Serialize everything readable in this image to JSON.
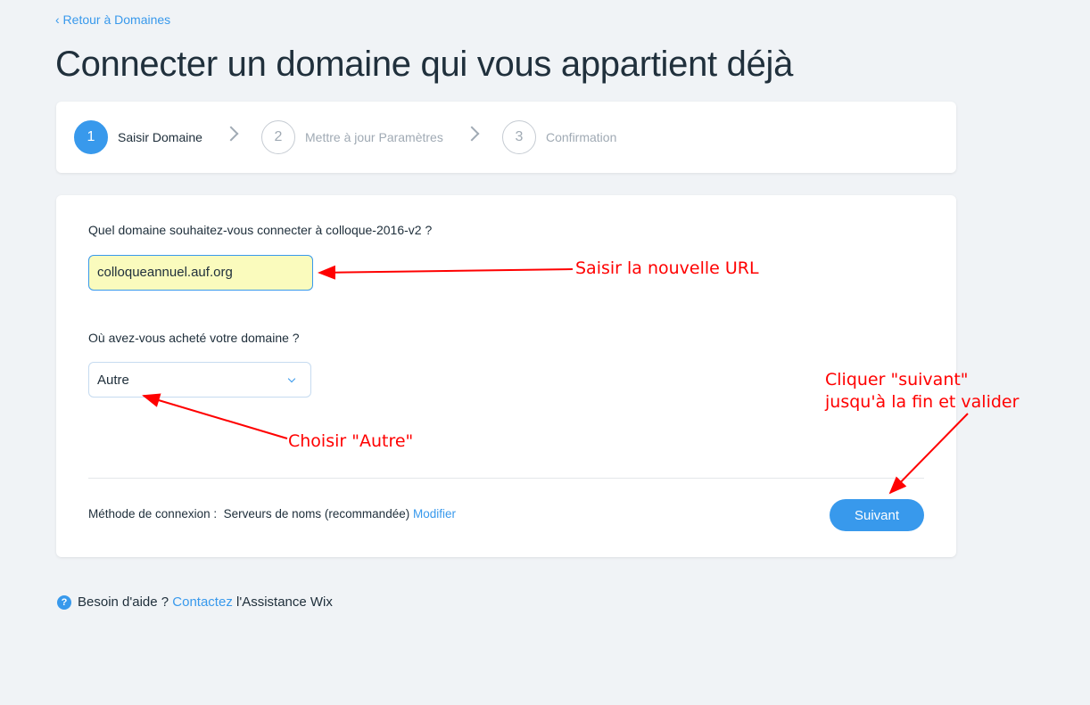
{
  "back_link": "‹ Retour à Domaines",
  "title": "Connecter un domaine qui vous appartient déjà",
  "steps": [
    {
      "number": "1",
      "label": "Saisir Domaine",
      "active": true
    },
    {
      "number": "2",
      "label": "Mettre à jour Paramètres",
      "active": false
    },
    {
      "number": "3",
      "label": "Confirmation",
      "active": false
    }
  ],
  "form": {
    "domain_question": "Quel domaine souhaitez-vous connecter à colloque-2016-v2 ?",
    "domain_value": "colloqueannuel.auf.org",
    "registrar_question": "Où avez-vous acheté votre domaine ?",
    "registrar_value": "Autre",
    "method_label": "Méthode de connexion :",
    "method_value": "Serveurs de noms (recommandée)",
    "modify_link": "Modifier",
    "next_button": "Suivant"
  },
  "help": {
    "prefix": "Besoin d'aide ?",
    "link": "Contactez",
    "suffix": "l'Assistance Wix"
  },
  "annotations": {
    "url": "Saisir la nouvelle URL",
    "autre": "Choisir \"Autre\"",
    "next_line1": "Cliquer \"suivant\"",
    "next_line2": "jusqu'à la fin et valider"
  },
  "colors": {
    "accent": "#3899ec",
    "annotation": "#ff0000"
  }
}
